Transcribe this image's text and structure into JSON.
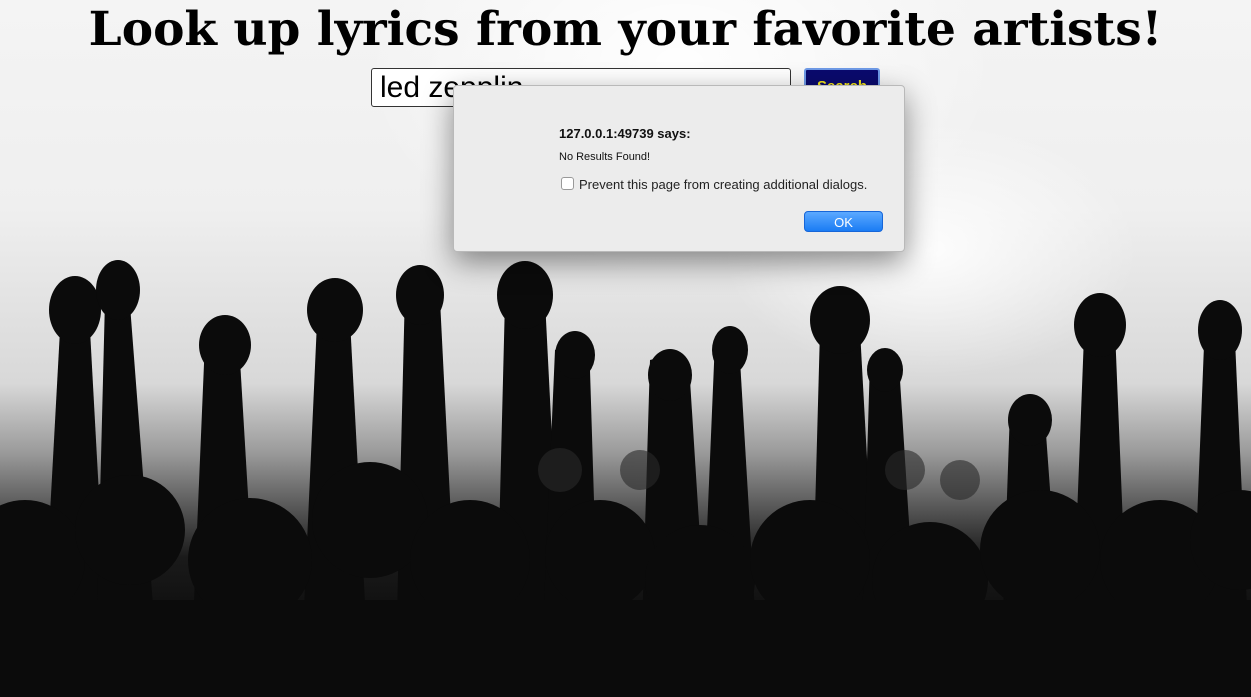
{
  "header": {
    "title": "Look up lyrics from your favorite artists!"
  },
  "search": {
    "value": "led zepplin",
    "button_label": "Search"
  },
  "dialog": {
    "title": "127.0.0.1:49739 says:",
    "message": "No Results Found!",
    "checkbox_label": "Prevent this page from creating additional dialogs.",
    "checkbox_checked": false,
    "ok_label": "OK"
  },
  "colors": {
    "button_bg": "#0a0a6e",
    "button_text": "#f5e81a",
    "ok_button": "#1a7cf4"
  }
}
